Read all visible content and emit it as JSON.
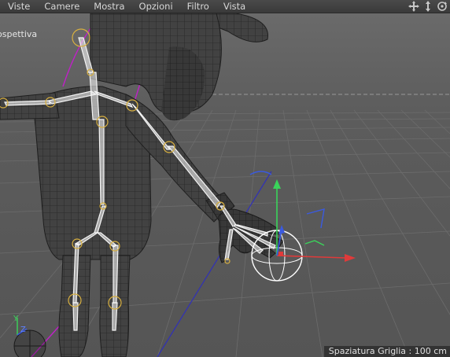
{
  "menubar": {
    "items": [
      "Viste",
      "Camere",
      "Mostra",
      "Opzioni",
      "Filtro",
      "Vista"
    ]
  },
  "nav_icons": [
    "move-view-icon",
    "pan-view-icon",
    "rotate-view-icon"
  ],
  "viewport": {
    "view_name": "ospettiva",
    "grid_status": "Spaziatura Griglia : 100 cm",
    "mini_axis": {
      "y": "Y",
      "z": "Z"
    }
  },
  "colors": {
    "background": "#5a5a5a",
    "mesh": "#3d3d3d",
    "wire": "#1e1e1e",
    "bone": "#ffffff",
    "joint": "#d8b040",
    "axis_x": "#e03a3a",
    "axis_y": "#3ad45a",
    "axis_z": "#3a5ae0",
    "spline": "#c020c8"
  }
}
